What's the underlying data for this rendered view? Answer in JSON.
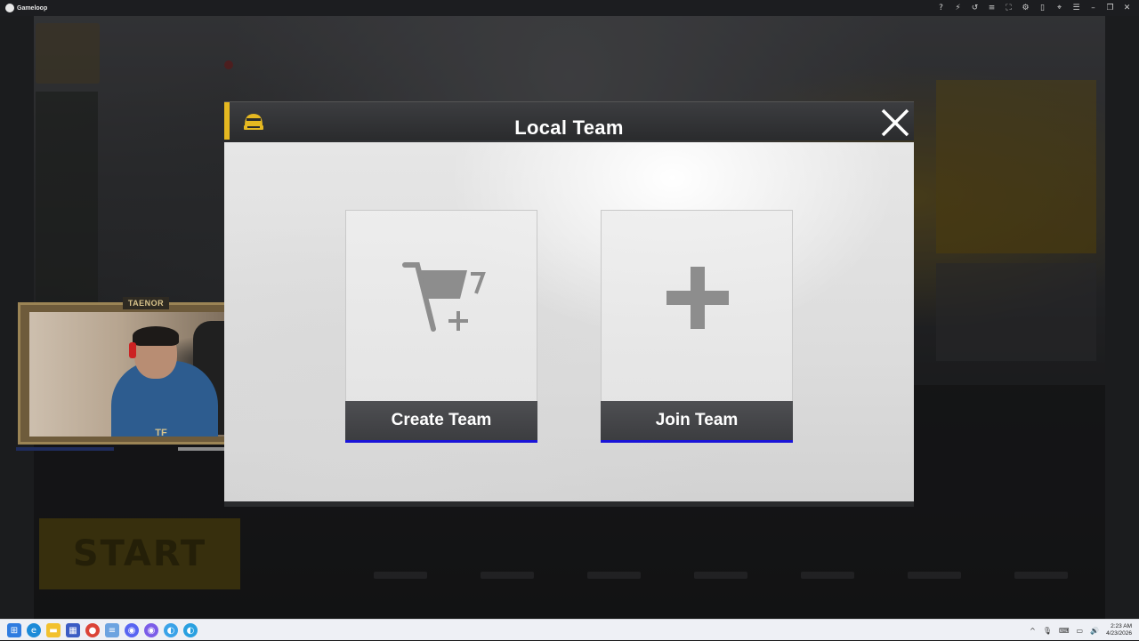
{
  "window": {
    "app_title": "Gameloop",
    "toolbar_icons": [
      "help-icon",
      "lightning-icon",
      "undo-icon",
      "list-icon",
      "fullscreen-icon",
      "settings-icon",
      "sidebar-icon",
      "pin-icon",
      "menu-icon",
      "minimize-icon",
      "restore-icon",
      "close-icon"
    ]
  },
  "background": {
    "start_label": "START",
    "webcam_tag": "TAENOR",
    "webcam_logo": "TF"
  },
  "dialog": {
    "title": "Local Team",
    "accent_color": "#e5b821",
    "options": [
      {
        "label": "Create Team",
        "icon": "cart-plus-icon"
      },
      {
        "label": "Join Team",
        "icon": "plus-icon"
      }
    ],
    "footer_highlight_color": "#1a14d8"
  },
  "taskbar": {
    "apps": [
      "windows-start-icon",
      "edge-icon",
      "file-explorer-icon",
      "store-icon",
      "chrome-icon",
      "notepad-icon",
      "discord-icon",
      "discord-alt-icon",
      "gameloop-icon",
      "gameloop-active-icon"
    ],
    "time": "2:23 AM",
    "date": "4/23/2026"
  }
}
